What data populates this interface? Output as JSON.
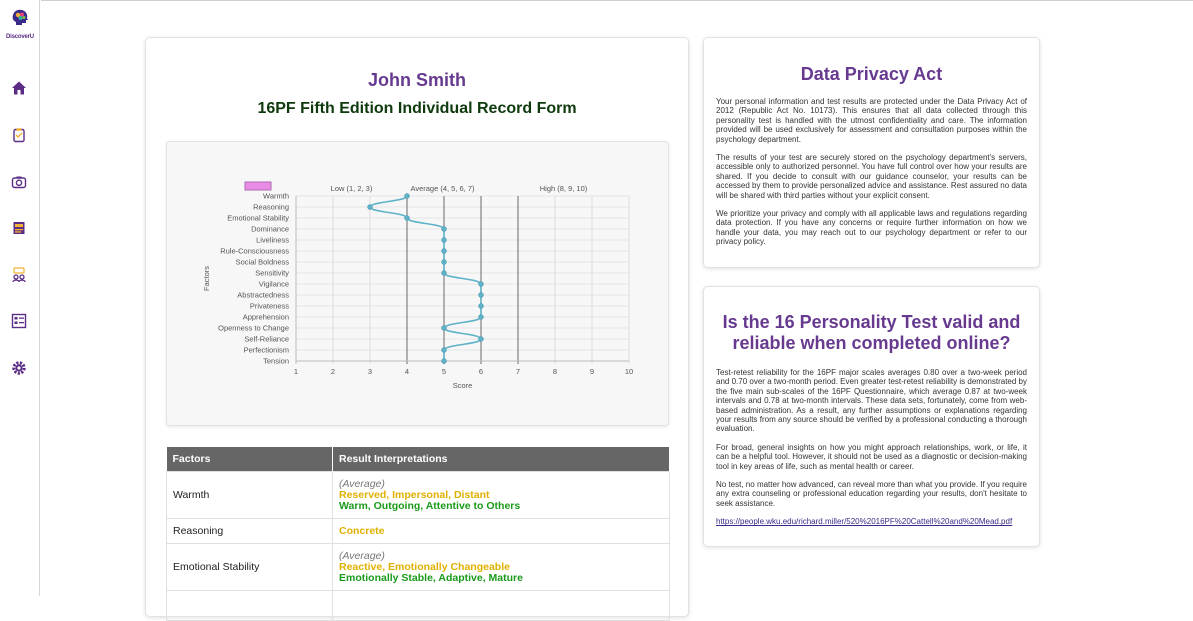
{
  "app": {
    "brand": "DiscoverU"
  },
  "sidebar": {
    "icons": [
      "home-icon",
      "clipboard-icon",
      "camera-icon",
      "book-icon",
      "people-icon",
      "list-icon",
      "gear-icon"
    ]
  },
  "profile": {
    "name": "John Smith",
    "form_title": "16PF Fifth Edition Individual Record Form"
  },
  "chart_data": {
    "type": "line",
    "categories": [
      "Warmth",
      "Reasoning",
      "Emotional Stability",
      "Dominance",
      "Liveliness",
      "Rule-Consciousness",
      "Social Boldness",
      "Sensitivity",
      "Vigilance",
      "Abstractedness",
      "Privateness",
      "Apprehension",
      "Openness to Change",
      "Self-Reliance",
      "Perfectionism",
      "Tension"
    ],
    "values": [
      4,
      3,
      4,
      5,
      5,
      5,
      5,
      5,
      6,
      6,
      6,
      6,
      5,
      6,
      5,
      5
    ],
    "xlabel": "Score",
    "ylabel": "Factors",
    "xlim": [
      1,
      10
    ],
    "xticks": [
      "1",
      "2",
      "3",
      "4",
      "5",
      "6",
      "7",
      "8",
      "9",
      "10"
    ],
    "bands": [
      "Low (1, 2, 3)",
      "Average (4, 5, 6, 7)",
      "High (8, 9, 10)"
    ],
    "color": "#5fb3c8",
    "legend_color": "#e98ce6",
    "grid": true
  },
  "table": {
    "headers": [
      "Factors",
      "Result Interpretations"
    ],
    "rows": [
      {
        "factor": "Warmth",
        "avg": "(Average)",
        "low": "Reserved, Impersonal, Distant",
        "high": "Warm, Outgoing, Attentive to Others"
      },
      {
        "factor": "Reasoning",
        "avg": "",
        "low": "Concrete",
        "high": ""
      },
      {
        "factor": "Emotional Stability",
        "avg": "(Average)",
        "low": "Reactive, Emotionally Changeable",
        "high": "Emotionally Stable, Adaptive, Mature"
      }
    ]
  },
  "privacy": {
    "title": "Data Privacy Act",
    "paragraphs": [
      "Your personal information and test results are protected under the Data Privacy Act of 2012 (Republic Act No. 10173). This ensures that all data collected through this personality test is handled with the utmost confidentiality and care. The information provided will be used exclusively for assessment and consultation purposes within the psychology department.",
      "The results of your test are securely stored on the psychology department's servers, accessible only to authorized personnel. You have full control over how your results are shared. If you decide to consult with our guidance counselor, your results can be accessed by them to provide personalized advice and assistance. Rest assured no data will be shared with third parties without your explicit consent.",
      "We prioritize your privacy and comply with all applicable laws and regulations regarding data protection. If you have any concerns or require further information on how we handle your data, you may reach out to our psychology department or refer to our privacy policy."
    ]
  },
  "validity": {
    "title": "Is the 16 Personality Test valid and reliable when completed online?",
    "paragraphs": [
      "Test-retest reliability for the 16PF major scales averages 0.80 over a two-week period and 0.70 over a two-month period. Even greater test-retest reliability is demonstrated by the five main sub-scales of the 16PF Questionnaire, which average 0.87 at two-week intervals and 0.78 at two-month intervals. These data sets, fortunately, come from web-based administration. As a result, any further assumptions or explanations regarding your results from any source should be verified by a professional conducting a thorough evaluation.",
      "For broad, general insights on how you might approach relationships, work, or life, it can be a helpful tool. However, it should not be used as a diagnostic or decision-making tool in key areas of life, such as mental health or career.",
      "No test, no matter how advanced, can reveal more than what you provide. If you require any extra counseling or professional education regarding your results, don't hesitate to seek assistance."
    ],
    "link": "https://people.wku.edu/richard.miller/520%2016PF%20Cattell%20and%20Mead.pdf"
  }
}
